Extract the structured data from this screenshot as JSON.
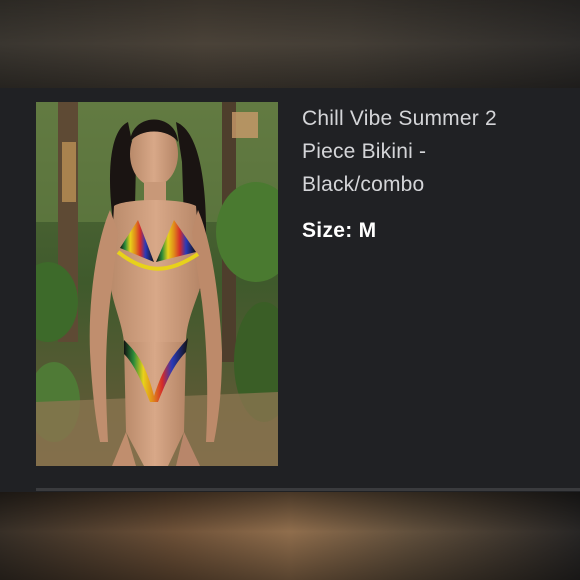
{
  "listing": {
    "title": "Chill Vibe Summer 2 Piece Bikini - Black/combo",
    "size_label": "Size:",
    "size_value": "M",
    "photo_icon": "product-photo"
  },
  "colors": {
    "card_background": "#202124",
    "title_text": "#d4d5d8",
    "size_text": "#ffffff"
  }
}
